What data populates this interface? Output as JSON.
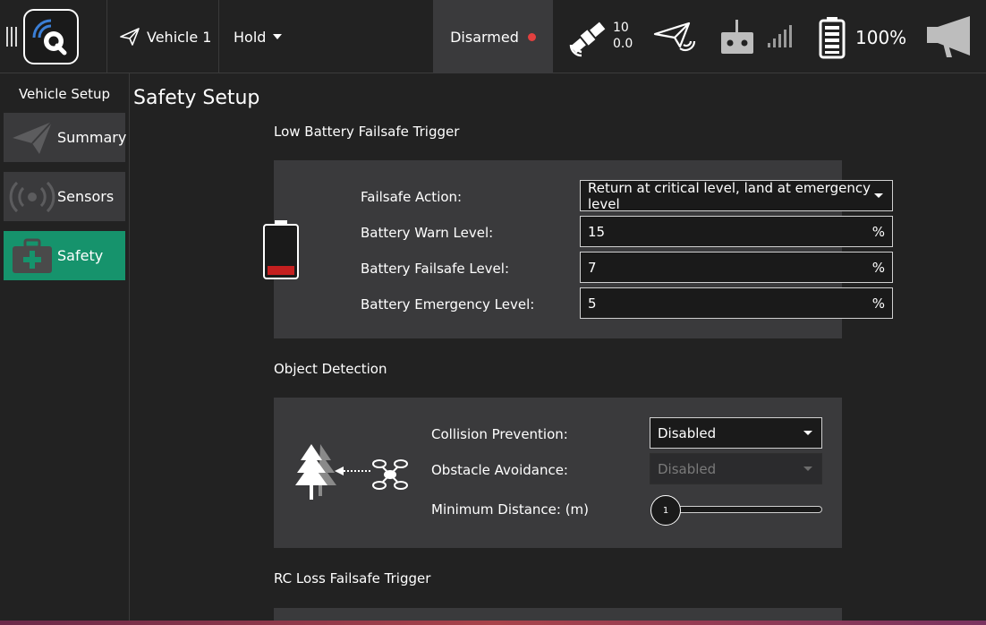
{
  "toolbar": {
    "vehicle_label": "Vehicle 1",
    "flight_mode": "Hold",
    "arm_status": "Disarmed",
    "gps_sat_count": "10",
    "gps_hdop": "0.0",
    "battery_percent": "100%",
    "icons": [
      "menu-handle-icon",
      "qgc-logo",
      "paper-plane-icon",
      "gps-satellite-icon",
      "telemetry-plane-icon",
      "rc-transmitter-icon",
      "signal-bars-icon",
      "battery-icon",
      "megaphone-icon"
    ]
  },
  "sidebar": {
    "title": "Vehicle Setup",
    "items": [
      {
        "label": "Summary",
        "icon": "paper-plane-icon",
        "active": false
      },
      {
        "label": "Sensors",
        "icon": "radar-icon",
        "active": false
      },
      {
        "label": "Safety",
        "icon": "first-aid-kit-icon",
        "active": true
      }
    ]
  },
  "page": {
    "title": "Safety Setup"
  },
  "low_battery": {
    "section_title": "Low Battery Failsafe Trigger",
    "failsafe_action_label": "Failsafe Action:",
    "failsafe_action_value": "Return at critical level, land at emergency level",
    "warn_label": "Battery Warn Level:",
    "warn_value": "15",
    "failsafe_label": "Battery Failsafe Level:",
    "failsafe_value": "7",
    "emergency_label": "Battery Emergency Level:",
    "emergency_value": "5",
    "unit": "%"
  },
  "object_detection": {
    "section_title": "Object Detection",
    "collision_label": "Collision Prevention:",
    "collision_value": "Disabled",
    "obstacle_label": "Obstacle Avoidance:",
    "obstacle_value": "Disabled",
    "min_distance_label": "Minimum Distance: (m)",
    "min_distance_value": "1"
  },
  "rc_loss": {
    "section_title": "RC Loss Failsafe Trigger"
  },
  "colors": {
    "accent": "#16936c",
    "panel": "#3a3a3c",
    "background": "#222222",
    "status_red": "#e2403f",
    "battery_fill": "#c41f1f"
  }
}
